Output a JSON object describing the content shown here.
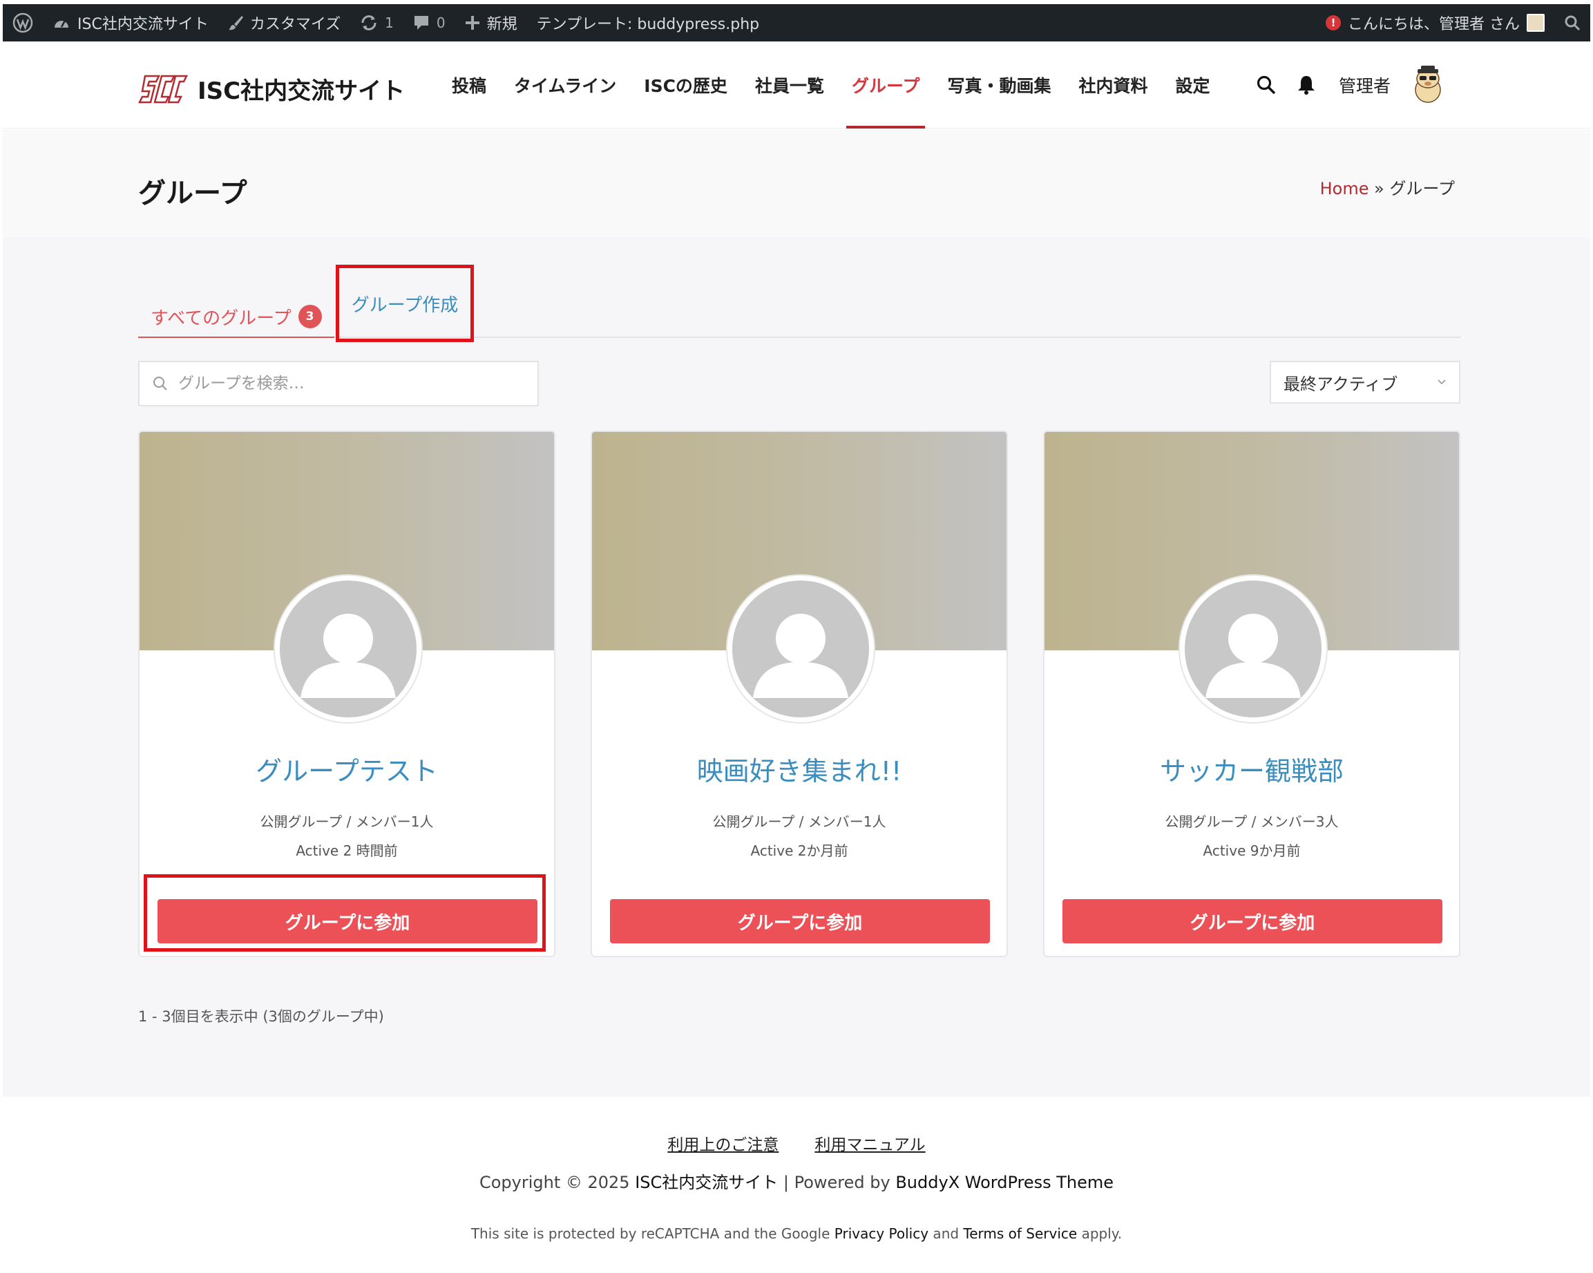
{
  "adminbar": {
    "site_name": "ISC社内交流サイト",
    "customize": "カスタマイズ",
    "updates_count": "1",
    "comments_count": "0",
    "new_label": "新規",
    "template": "テンプレート: buddypress.php",
    "greeting": "こんにちは、管理者 さん",
    "notice_glyph": "!"
  },
  "header": {
    "site_title": "ISC社内交流サイト",
    "nav": [
      "投稿",
      "タイムライン",
      "ISCの歴史",
      "社員一覧",
      "グループ",
      "写真・動画集",
      "社内資料",
      "設定"
    ],
    "active_nav": "グループ",
    "user_name": "管理者"
  },
  "page": {
    "title": "グループ",
    "breadcrumb_home": "Home",
    "breadcrumb_sep": " » ",
    "breadcrumb_current": "グループ"
  },
  "tabs": {
    "all_label": "すべてのグループ",
    "all_count": "3",
    "create_label": "グループ作成"
  },
  "search": {
    "placeholder": "グループを検索…"
  },
  "sort": {
    "selected": "最終アクティブ"
  },
  "groups": [
    {
      "name": "グループテスト",
      "meta": "公開グループ / メンバー1人",
      "active": "Active 2 時間前",
      "button": "グループに参加"
    },
    {
      "name": "映画好き集まれ!!",
      "meta": "公開グループ / メンバー1人",
      "active": "Active 2か月前",
      "button": "グループに参加"
    },
    {
      "name": "サッカー観戦部",
      "meta": "公開グループ / メンバー3人",
      "active": "Active 9か月前",
      "button": "グループに参加"
    }
  ],
  "pagination": {
    "info": "1 - 3個目を表示中 (3個のグループ中)"
  },
  "footer": {
    "links": [
      "利用上のご注意",
      "利用マニュアル"
    ],
    "copyright_prefix": "Copyright © 2025 ",
    "copyright_site": "ISC社内交流サイト",
    "copyright_mid": " | Powered by ",
    "copyright_theme": "BuddyX WordPress Theme",
    "recaptcha_prefix": "This site is protected by reCAPTCHA and the Google ",
    "privacy": "Privacy Policy",
    "recaptcha_and": " and ",
    "terms": "Terms of Service",
    "recaptcha_suffix": " apply."
  },
  "colors": {
    "accent": "#e05357",
    "brand_red": "#b42a2f",
    "link_blue": "#3a8dbf",
    "join_button": "#ec5157",
    "highlight_box": "#e0131a",
    "adminbar_bg": "#1d2327"
  },
  "icons": [
    "wordpress-icon",
    "dashboard-icon",
    "brush-icon",
    "refresh-icon",
    "comment-icon",
    "plus-icon",
    "search-icon",
    "bell-icon",
    "chevron-down-icon",
    "user-placeholder-icon"
  ]
}
